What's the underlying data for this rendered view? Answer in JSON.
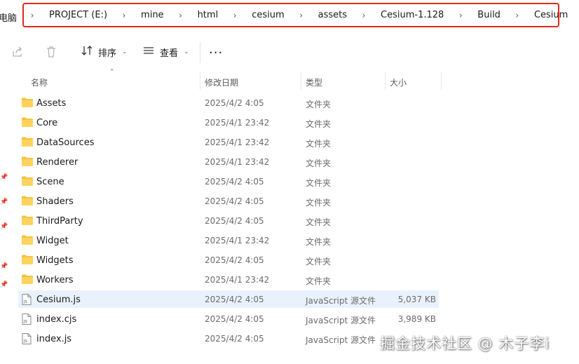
{
  "breadcrumb": {
    "root": "电脑",
    "items": [
      "PROJECT (E:)",
      "mine",
      "html",
      "cesium",
      "assets",
      "Cesium-1.128",
      "Build",
      "Cesium"
    ],
    "highlight_color": "#e0281e"
  },
  "toolbar": {
    "share_icon": "share-icon",
    "delete_icon": "delete-icon",
    "sort_label": "排序",
    "view_label": "查看",
    "more_label": "..."
  },
  "columns": {
    "name": "名称",
    "date": "修改日期",
    "type": "类型",
    "size": "大小"
  },
  "files": [
    {
      "name": "Assets",
      "date": "2025/4/2 4:05",
      "type": "文件夹",
      "size": "",
      "kind": "folder"
    },
    {
      "name": "Core",
      "date": "2025/4/1 23:42",
      "type": "文件夹",
      "size": "",
      "kind": "folder"
    },
    {
      "name": "DataSources",
      "date": "2025/4/1 23:42",
      "type": "文件夹",
      "size": "",
      "kind": "folder"
    },
    {
      "name": "Renderer",
      "date": "2025/4/1 23:42",
      "type": "文件夹",
      "size": "",
      "kind": "folder"
    },
    {
      "name": "Scene",
      "date": "2025/4/2 4:05",
      "type": "文件夹",
      "size": "",
      "kind": "folder"
    },
    {
      "name": "Shaders",
      "date": "2025/4/2 4:05",
      "type": "文件夹",
      "size": "",
      "kind": "folder"
    },
    {
      "name": "ThirdParty",
      "date": "2025/4/2 4:05",
      "type": "文件夹",
      "size": "",
      "kind": "folder"
    },
    {
      "name": "Widget",
      "date": "2025/4/1 23:42",
      "type": "文件夹",
      "size": "",
      "kind": "folder"
    },
    {
      "name": "Widgets",
      "date": "2025/4/2 4:05",
      "type": "文件夹",
      "size": "",
      "kind": "folder"
    },
    {
      "name": "Workers",
      "date": "2025/4/1 23:42",
      "type": "文件夹",
      "size": "",
      "kind": "folder"
    },
    {
      "name": "Cesium.js",
      "date": "2025/4/2 4:05",
      "type": "JavaScript 源文件",
      "size": "5,037 KB",
      "kind": "js",
      "selected": true
    },
    {
      "name": "index.cjs",
      "date": "2025/4/2 4:05",
      "type": "JavaScript 源文件",
      "size": "3,989 KB",
      "kind": "js"
    },
    {
      "name": "index.js",
      "date": "2025/4/2 4:05",
      "type": "JavaScript 源文件",
      "size": "",
      "kind": "js"
    }
  ],
  "watermark": "掘金技术社区 @ 木子李i",
  "colors": {
    "selected_row": "#e9f2fc",
    "folder": "#f5c342"
  }
}
